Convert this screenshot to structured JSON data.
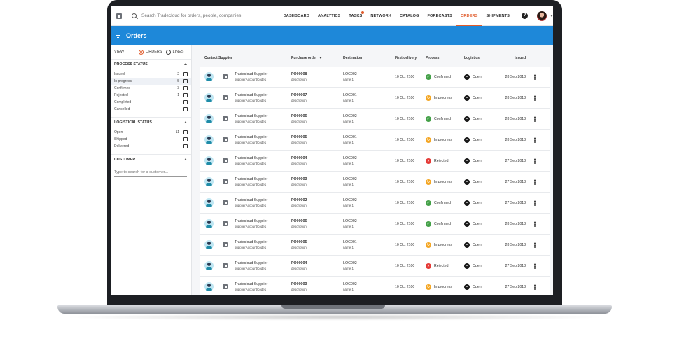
{
  "search": {
    "placeholder": "Search Tradecloud for orders, people, companies"
  },
  "nav": [
    {
      "label": "DASHBOARD"
    },
    {
      "label": "ANALYTICS"
    },
    {
      "label": "TASKS"
    },
    {
      "label": "NETWORK"
    },
    {
      "label": "CATALOG"
    },
    {
      "label": "FORECASTS"
    },
    {
      "label": "ORDERS"
    },
    {
      "label": "SHIPMENTS"
    }
  ],
  "help_label": "?",
  "header": {
    "title": "Orders"
  },
  "sidebar": {
    "view_label": "VIEW",
    "view_options": [
      "ORDERS",
      "LINES"
    ],
    "process_status": {
      "title": "PROCESS STATUS",
      "items": [
        {
          "label": "Issued",
          "count": "2"
        },
        {
          "label": "In progress",
          "count": "5"
        },
        {
          "label": "Confirmed",
          "count": "3"
        },
        {
          "label": "Rejected",
          "count": "1"
        },
        {
          "label": "Completed",
          "count": ""
        },
        {
          "label": "Cancelled",
          "count": ""
        }
      ]
    },
    "logistical_status": {
      "title": "LOGISTICAL STATUS",
      "items": [
        {
          "label": "Open",
          "count": "11"
        },
        {
          "label": "Shipped",
          "count": ""
        },
        {
          "label": "Delivered",
          "count": ""
        }
      ]
    },
    "customer": {
      "title": "CUSTOMER",
      "placeholder": "Type to search for a customer..."
    }
  },
  "table": {
    "columns": {
      "contact": "Contact",
      "supplier": "Supplier",
      "po": "Purchase order",
      "destination": "Destination",
      "first_delivery": "First delivery",
      "process": "Process",
      "logistics": "Logistics",
      "issued": "Issued"
    },
    "rows": [
      {
        "supplier": "Tradecloud Supplier",
        "code": "supplierAccountCode1",
        "po": "PO00008",
        "desc": "description",
        "dest": "LOC002",
        "dest_name": "name 1",
        "delivery": "10 Oct 2100",
        "process": "Confirmed",
        "process_type": "ok",
        "logistics": "Open",
        "issued": "28 Sep 2018"
      },
      {
        "supplier": "Tradecloud Supplier",
        "code": "supplierAccountCode1",
        "po": "PO00007",
        "desc": "description",
        "dest": "LOC001",
        "dest_name": "name 1",
        "delivery": "10 Oct 2100",
        "process": "In progress",
        "process_type": "prog",
        "logistics": "Open",
        "issued": "28 Sep 2018"
      },
      {
        "supplier": "Tradecloud Supplier",
        "code": "supplierAccountCode1",
        "po": "PO00006",
        "desc": "description",
        "dest": "LOC002",
        "dest_name": "name 1",
        "delivery": "10 Oct 2100",
        "process": "Confirmed",
        "process_type": "ok",
        "logistics": "Open",
        "issued": "28 Sep 2018"
      },
      {
        "supplier": "Tradecloud Supplier",
        "code": "supplierAccountCode1",
        "po": "PO00005",
        "desc": "description",
        "dest": "LOC001",
        "dest_name": "name 1",
        "delivery": "10 Oct 2100",
        "process": "In progress",
        "process_type": "prog",
        "logistics": "Open",
        "issued": "28 Sep 2018"
      },
      {
        "supplier": "Tradecloud Supplier",
        "code": "supplierAccountCode1",
        "po": "PO00004",
        "desc": "description",
        "dest": "LOC002",
        "dest_name": "name 1",
        "delivery": "10 Oct 2100",
        "process": "Rejected",
        "process_type": "rej",
        "logistics": "Open",
        "issued": "27 Sep 2018"
      },
      {
        "supplier": "Tradecloud Supplier",
        "code": "supplierAccountCode1",
        "po": "PO00003",
        "desc": "description",
        "dest": "LOC002",
        "dest_name": "name 1",
        "delivery": "10 Oct 2100",
        "process": "In progress",
        "process_type": "prog",
        "logistics": "Open",
        "issued": "27 Sep 2018"
      },
      {
        "supplier": "Tradecloud Supplier",
        "code": "supplierAccountCode1",
        "po": "PO00002",
        "desc": "description",
        "dest": "LOC002",
        "dest_name": "name 1",
        "delivery": "10 Oct 2100",
        "process": "Confirmed",
        "process_type": "ok",
        "logistics": "Open",
        "issued": "27 Sep 2018"
      },
      {
        "supplier": "Tradecloud Supplier",
        "code": "supplierAccountCode1",
        "po": "PO00006",
        "desc": "description",
        "dest": "LOC002",
        "dest_name": "name 1",
        "delivery": "10 Oct 2100",
        "process": "Confirmed",
        "process_type": "ok",
        "logistics": "Open",
        "issued": "28 Sep 2018"
      },
      {
        "supplier": "Tradecloud Supplier",
        "code": "supplierAccountCode1",
        "po": "PO00005",
        "desc": "description",
        "dest": "LOC001",
        "dest_name": "name 1",
        "delivery": "10 Oct 2100",
        "process": "In progress",
        "process_type": "prog",
        "logistics": "Open",
        "issued": "28 Sep 2018"
      },
      {
        "supplier": "Tradecloud Supplier",
        "code": "supplierAccountCode1",
        "po": "PO00004",
        "desc": "description",
        "dest": "LOC002",
        "dest_name": "name 1",
        "delivery": "10 Oct 2100",
        "process": "Rejected",
        "process_type": "rej",
        "logistics": "Open",
        "issued": "27 Sep 2018"
      },
      {
        "supplier": "Tradecloud Supplier",
        "code": "supplierAccountCode1",
        "po": "PO00003",
        "desc": "description",
        "dest": "LOC002",
        "dest_name": "name 1",
        "delivery": "10 Oct 2100",
        "process": "In progress",
        "process_type": "prog",
        "logistics": "Open",
        "issued": "27 Sep 2018"
      }
    ]
  },
  "colors": {
    "accent": "#e05a2a",
    "header": "#1e88d9",
    "confirmed": "#43a047",
    "in_progress": "#f4a623",
    "rejected": "#e53935"
  }
}
